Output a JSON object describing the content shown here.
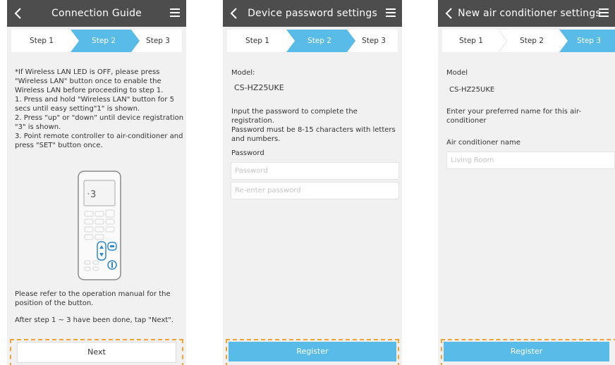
{
  "accent_color": "#58bbe8",
  "highlight_color": "#f0a235",
  "screens": [
    {
      "title": "Connection Guide",
      "steps": [
        "Step 1",
        "Step 2",
        "Step 3"
      ],
      "active_step": 2,
      "instructions": [
        "*If Wireless LAN LED is OFF, please press",
        "\"Wireless LAN\" button once to enable the",
        "Wireless LAN before proceeding to step 1.",
        "1. Press and hold \"Wireless LAN\" button for 5",
        "secs until easy setting\"1\" is shown.",
        "2. Press \"up\" or \"down\" until device registration",
        "\"3\" is shown.",
        "3. Point remote controller to air-conditioner and",
        "press \"SET\" button once."
      ],
      "remote_display": "3",
      "note_lines": [
        "Please refer to the operation manual for the",
        "position of the button."
      ],
      "after_text": "After step 1 ~ 3 have been done, tap \"Next\".",
      "button": "Next"
    },
    {
      "title": "Device password settings",
      "steps": [
        "Step 1",
        "Step 2",
        "Step 3"
      ],
      "active_step": 2,
      "model_label": "Model:",
      "model_value": "CS-HZ25UKE",
      "info_lines": [
        "Input the password to complete the registration.",
        "Password must be 8-15 characters with letters",
        "and numbers."
      ],
      "password_label": "Password",
      "password_placeholder": "Password",
      "reenter_placeholder": "Re-enter password",
      "button": "Register"
    },
    {
      "title": "New air conditioner settings",
      "steps": [
        "Step 1",
        "Step 2",
        "Step 3"
      ],
      "active_step": 3,
      "model_label": "Model",
      "model_value": "CS-HZ25UKE",
      "info_lines": [
        "Enter your preferred name for this air-",
        "conditioner"
      ],
      "name_label": "Air conditioner name",
      "name_placeholder": "Living Room",
      "button": "Register"
    }
  ]
}
